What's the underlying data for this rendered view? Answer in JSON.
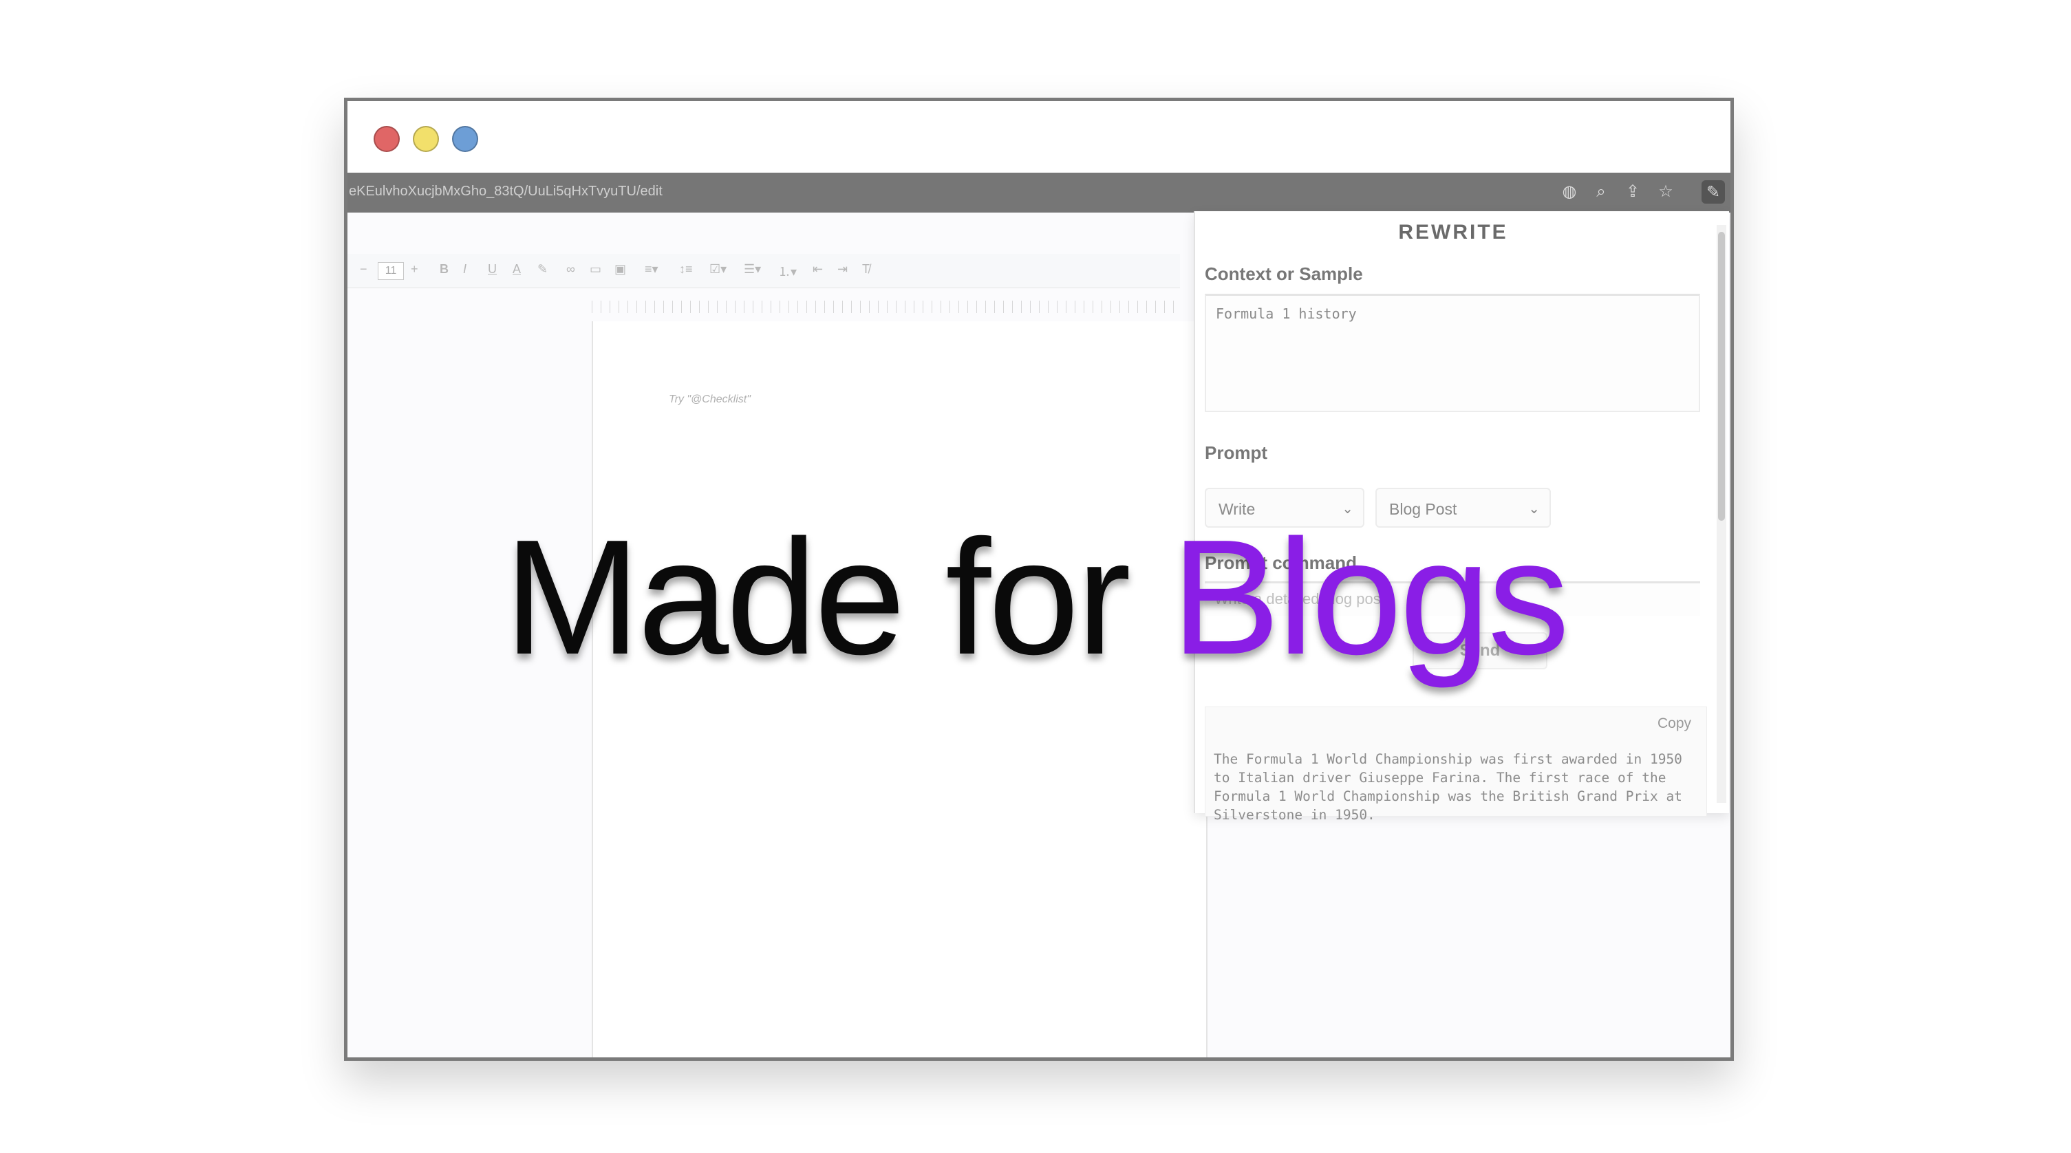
{
  "browser": {
    "url": "eKEulvhoXucjbMxGho_83tQ/UuLi5qHxTvyuTU/edit"
  },
  "docs": {
    "font_size": "11",
    "hint": "Try \"@Checklist\""
  },
  "panel": {
    "title": "REWRITE",
    "context_label": "Context or Sample",
    "context_value": "Formula 1 history",
    "prompt_label": "Prompt",
    "mode_select": "Write",
    "type_select": "Blog Post",
    "command_label": "Prompt command",
    "command_placeholder": "Write a detailed blog post",
    "send_label": "Send",
    "copy_label": "Copy",
    "output": "The Formula 1 World Championship was first awarded in 1950 to Italian driver Giuseppe Farina. The first race of the Formula 1 World Championship was the British Grand Prix at Silverstone in 1950."
  },
  "overlay": {
    "part1": "Made for",
    "part2": "Blogs",
    "accent_color": "#8a1ee6"
  },
  "icons": [
    "google-icon",
    "zoom-icon",
    "share-icon",
    "star-icon",
    "extension-icon"
  ]
}
